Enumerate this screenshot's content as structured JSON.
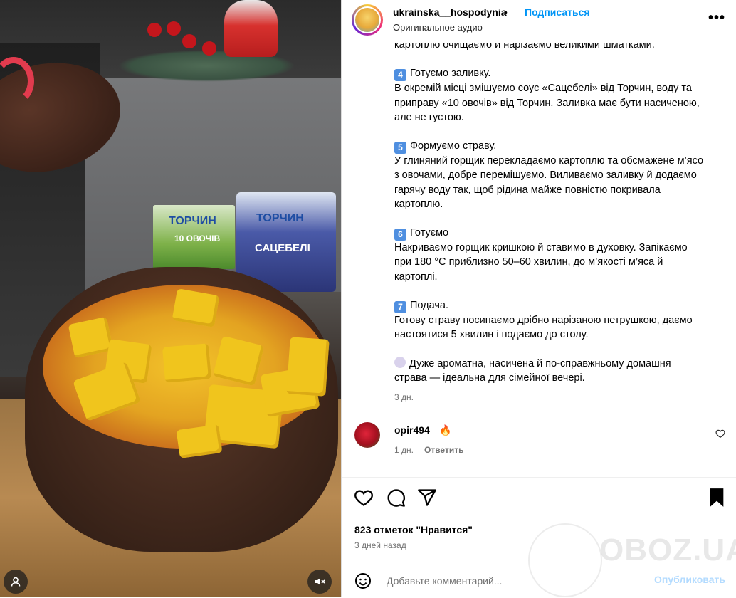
{
  "post": {
    "username": "ukrainska__hospodynia",
    "separator": "•",
    "follow_label": "Подписаться",
    "audio": "Оригинальное аудио",
    "more_icon": "more-horizontal-icon"
  },
  "media": {
    "pack1_label": "ТОРЧИН",
    "pack1_sub": "10 ОВОЧІВ",
    "pack2_label": "ТОРЧИН",
    "pack2_sub": "САЦЕБЕЛІ",
    "profile_icon": "user-icon",
    "mute_icon": "speaker-muted-icon"
  },
  "caption": {
    "top_partial": "картоплю очищаємо й нарізаємо великими шматками.",
    "steps": [
      {
        "num": "4",
        "title": "Готуємо заливку.",
        "lines": [
          "В окремій місці змішуємо соус «Сацебелі» від Торчин, воду та",
          "приправу «10 овочів» від Торчин. Заливка має бути насиченою,",
          "але не густою."
        ]
      },
      {
        "num": "5",
        "title": "Формуємо страву.",
        "lines": [
          "У глиняний горщик перекладаємо картоплю та обсмажене м’ясо",
          "з овочами, добре перемішуємо. Виливаємо заливку й додаємо",
          "гарячу воду так, щоб рідина майже повністю покривала",
          "картоплю."
        ]
      },
      {
        "num": "6",
        "title": "Готуємо",
        "lines": [
          "Накриваємо горщик кришкою й ставимо в духовку. Запікаємо",
          "при 180 °C приблизно 50–60 хвилин, до м’якості м’яса й",
          "картоплі."
        ]
      },
      {
        "num": "7",
        "title": "Подача.",
        "lines": [
          "Готову страву посипаємо дрібно нарізаною петрушкою, даємо",
          "настоятися 5 хвилин і подаємо до столу."
        ]
      }
    ],
    "final_line1": "Дуже ароматна, насичена й по-справжньому домашня",
    "final_line2": "страва — ідеальна для сімейної вечері.",
    "time": "3 дн."
  },
  "comment": {
    "user": "opir494",
    "emoji": "🔥",
    "time": "1 дн.",
    "reply_label": "Ответить",
    "like_icon": "heart-icon"
  },
  "actions": {
    "like_icon": "heart-icon",
    "comment_icon": "comment-icon",
    "share_icon": "share-icon",
    "save_icon": "bookmark-icon",
    "likes_text": "823 отметок \"Нравится\"",
    "posted_ago": "3 дней назад"
  },
  "add_comment": {
    "placeholder": "Добавьте комментарий...",
    "publish_label": "Опубликовать",
    "emoji_icon": "smiley-icon"
  },
  "watermark": {
    "text": "OBOZ.UA"
  }
}
